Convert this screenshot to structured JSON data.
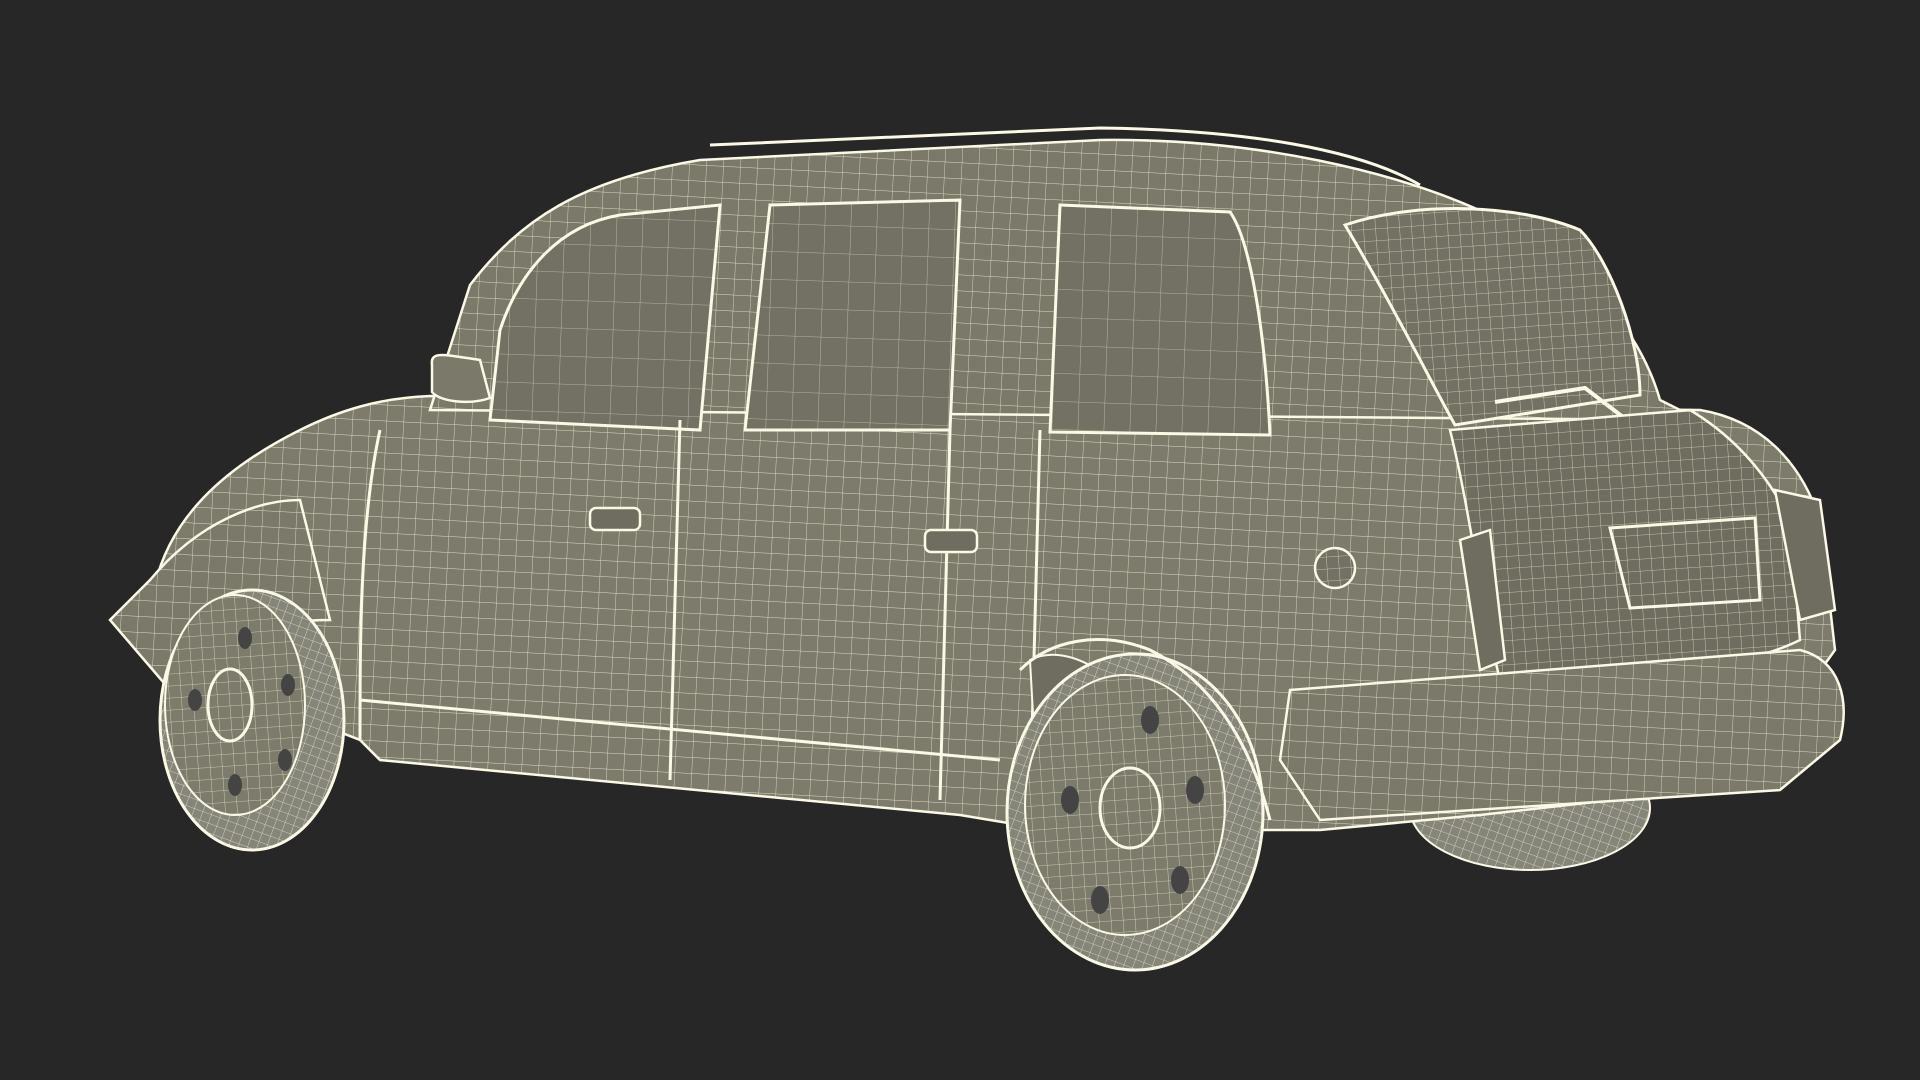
{
  "scene": {
    "subject": "wireframe-car-rear-three-quarter-view",
    "colors": {
      "background": "#272727",
      "body_fill": "#7d7c6c",
      "body_shade": "#6e6d5f",
      "glass_fill": "#727163",
      "tire_fill": "#86857a",
      "wire": "#eeeccf",
      "edge": "#fbf9e6"
    }
  }
}
